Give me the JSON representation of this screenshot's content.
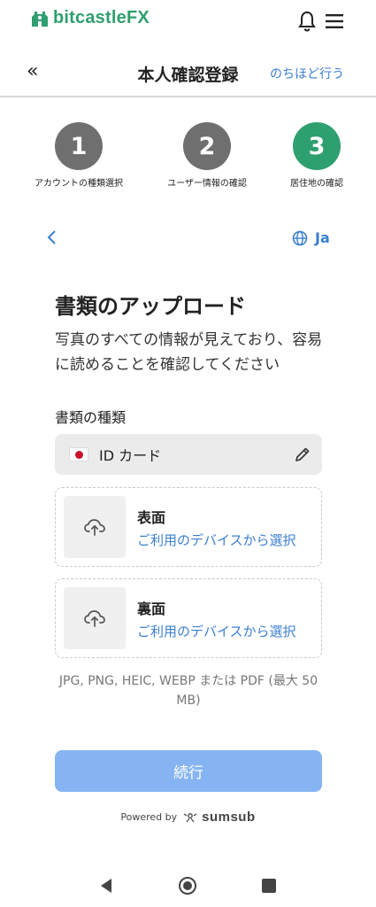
{
  "brand": {
    "name_part1": "bitcastle",
    "name_part2": "FX",
    "color": "#2e9f6e"
  },
  "header": {
    "back_glyph": "«",
    "title": "本人確認登録",
    "later_link": "のちほど行う"
  },
  "steps": [
    {
      "number": "1",
      "label": "アカウントの種類選択",
      "state": "done"
    },
    {
      "number": "2",
      "label": "ユーザー情報の確認",
      "state": "done"
    },
    {
      "number": "3",
      "label": "居住地の確認",
      "state": "active"
    }
  ],
  "subnav": {
    "back_glyph": "<",
    "language": "Ja"
  },
  "main": {
    "title": "書類のアップロード",
    "description": "写真のすべての情報が見えており、容易に読めることを確認してください",
    "doc_type_label": "書類の種類",
    "doc_type_value": "ID カード",
    "uploads": [
      {
        "title": "表面",
        "link": "ご利用のデバイスから選択"
      },
      {
        "title": "裏面",
        "link": "ご利用のデバイスから選択"
      }
    ],
    "formats_note": "JPG, PNG, HEIC, WEBP または PDF (最大 50 MB)",
    "continue_label": "続行"
  },
  "footer": {
    "powered_by": "Powered by",
    "provider": "sumsub"
  },
  "icons": {
    "logo": "bitcastle-logo-icon",
    "notification": "bell-icon",
    "menu": "hamburger-menu-icon",
    "language": "globe-icon",
    "edit": "pencil-icon",
    "upload": "cloud-upload-icon"
  },
  "colors": {
    "accent_green": "#2e9f6e",
    "link_blue": "#3a7fd0",
    "button_disabled": "#86b4f2",
    "step_gray": "#6f6f6f"
  }
}
